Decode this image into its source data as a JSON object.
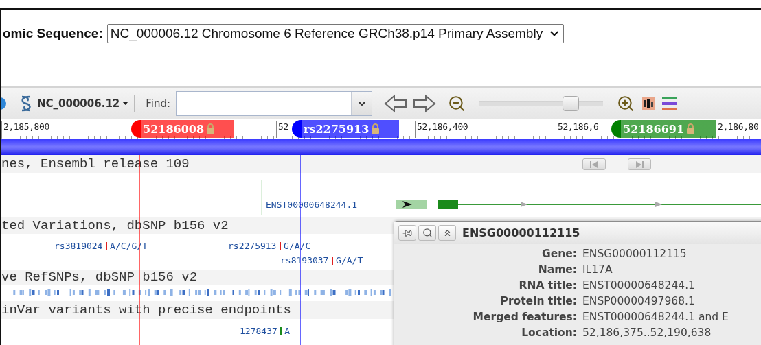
{
  "header": {
    "label": "omic Sequence:",
    "select_value": "NC_000006.12 Chromosome 6 Reference GRCh38.p14 Primary Assembly"
  },
  "toolbar": {
    "sequence": "NC_000006.12",
    "find_label": "Find:",
    "zoom": {
      "level": 0.74
    }
  },
  "ruler": {
    "ticks": [
      "2,185,800",
      "52",
      "52,186,400",
      "52,186,6",
      "2,186,80"
    ],
    "markers": [
      {
        "label": "52186008",
        "color": "#ff0000"
      },
      {
        "label": "rs2275913",
        "color": "#0000ff"
      },
      {
        "label": "52186691",
        "color": "#008000"
      }
    ]
  },
  "tracks": [
    {
      "title": "nes, Ensembl release 109",
      "kind": "genes",
      "features": [
        {
          "label": "ENST00000648244.1"
        }
      ]
    },
    {
      "title": "ted Variations, dbSNP b156 v2",
      "kind": "variations",
      "features": [
        {
          "label": "rs3819024",
          "alleles": "A/C/G/T"
        },
        {
          "label": "rs2275913",
          "alleles": "G/A/C"
        },
        {
          "label": "rs8193037",
          "alleles": "G/A/T"
        }
      ]
    },
    {
      "title": "ve RefSNPs, dbSNP b156 v2",
      "kind": "density"
    },
    {
      "title": "inVar variants with precise endpoints",
      "kind": "clinvar",
      "features": [
        {
          "label": "1278437",
          "alleles": "A"
        }
      ]
    }
  ],
  "popup": {
    "title": "ENSG00000112115",
    "rows": [
      {
        "label": "Gene:",
        "value": "ENSG00000112115"
      },
      {
        "label": "Name:",
        "value": "IL17A"
      },
      {
        "label": "RNA title:",
        "value": "ENST00000648244.1"
      },
      {
        "label": "Protein title:",
        "value": "ENSP00000497968.1"
      },
      {
        "label": "Merged features:",
        "value": "ENST00000648244.1 and E"
      },
      {
        "label": "Location:",
        "value": "52,186,375..52,190,638"
      }
    ]
  }
}
